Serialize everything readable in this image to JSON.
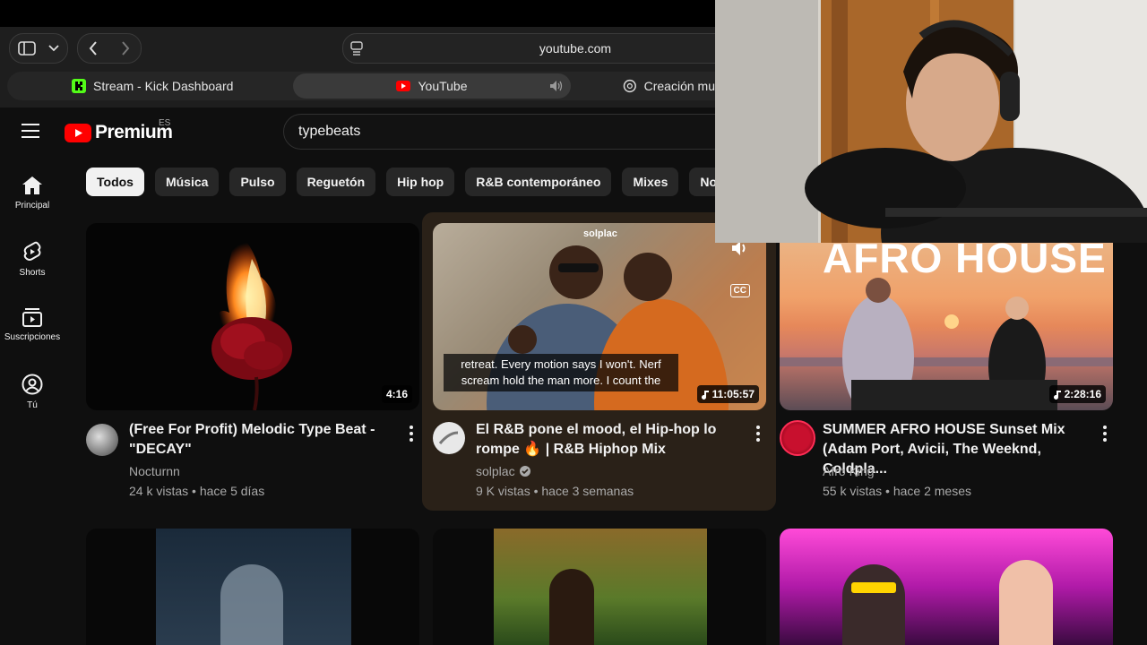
{
  "browser": {
    "url": "youtube.com",
    "tabs": [
      {
        "label": "Stream - Kick Dashboard",
        "icon": "kick-icon"
      },
      {
        "label": "YouTube",
        "icon": "youtube-icon",
        "active": true
      },
      {
        "label": "Creación mus",
        "icon": "openai-icon"
      }
    ]
  },
  "header": {
    "logo_text": "Premium",
    "region": "ES",
    "search_value": "typebeats"
  },
  "sidebar": {
    "items": [
      {
        "label": "Principal",
        "icon": "home-icon"
      },
      {
        "label": "Shorts",
        "icon": "shorts-icon"
      },
      {
        "label": "Suscripciones",
        "icon": "subscriptions-icon"
      },
      {
        "label": "Tú",
        "icon": "user-icon"
      }
    ]
  },
  "chips": [
    "Todos",
    "Música",
    "Pulso",
    "Reguetón",
    "Hip hop",
    "R&B contemporáneo",
    "Mixes",
    "Noticia"
  ],
  "videos": [
    {
      "title": "(Free For Profit) Melodic Type Beat - \"DECAY\"",
      "channel": "Nocturnn",
      "meta": "24 k vistas • hace 5 días",
      "duration": "4:16"
    },
    {
      "title": "El R&B pone el mood, el Hip-hop lo rompe 🔥 | R&B Hiphop Mix",
      "channel": "solplac",
      "meta": "9 K vistas • hace 3 semanas",
      "duration": "11:05:57",
      "thumb_label": "solplac",
      "subtitle": "retreat. Every motion says I won't. Nerf scream hold the man more. I count the",
      "cc": "CC"
    },
    {
      "title": "SUMMER AFRO HOUSE Sunset Mix (Adam Port, Avicii, The Weeknd, Coldpla...",
      "channel": "Afro King",
      "meta": "55 k vistas • hace 2 meses",
      "duration": "2:28:16",
      "thumb_text": "AFRO HOUSE"
    }
  ],
  "colors": {
    "background": "#0f0f0f",
    "youtube_red": "#ff0000",
    "chip": "#272727",
    "hover_card": "#2a2118"
  }
}
